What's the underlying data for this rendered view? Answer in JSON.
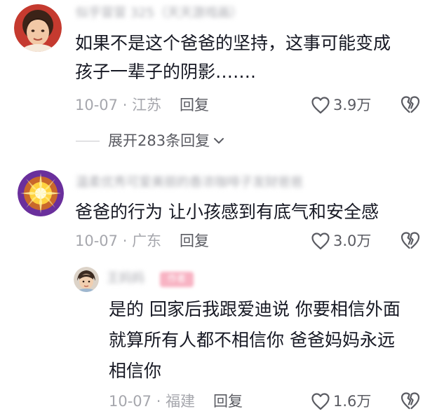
{
  "comments": [
    {
      "username": "似乎冒冒 325（天天游戏画）",
      "text_lines": [
        "如果不是这个爸爸的坚持，这事可能变成",
        "孩子一辈子的阴影……."
      ],
      "date": "10-07",
      "location": "江苏",
      "reply_label": "回复",
      "likes": "3.9万",
      "expand": {
        "label": "展开283条回复",
        "icon": "chevron-down-icon"
      }
    },
    {
      "username": "温柔优秀可爱美丽的香浓咖啡子发财爸爸",
      "text_lines": [
        "爸爸的行为 让小孩感到有底气和安全感"
      ],
      "date": "10-07",
      "location": "广东",
      "reply_label": "回复",
      "likes": "3.0万"
    }
  ],
  "reply": {
    "username": "王妈妈",
    "author_tag": "作者",
    "text_lines": [
      "是的 回家后我跟爱迪说 你要相信外面",
      "就算所有人都不相信你 爸爸妈妈永远",
      "相信你"
    ],
    "date": "10-07",
    "location": "福建",
    "reply_label": "回复",
    "likes": "1.6万"
  },
  "meta_separator": " · ",
  "icons": {
    "like": "heart-outline-icon",
    "dislike": "broken-heart-icon",
    "expand": "chevron-down-icon"
  },
  "colors": {
    "primary_text": "#161823",
    "secondary_text": "#a6a7ad",
    "action_text": "#5a5b62",
    "author_tag": "#f8b3c3"
  }
}
